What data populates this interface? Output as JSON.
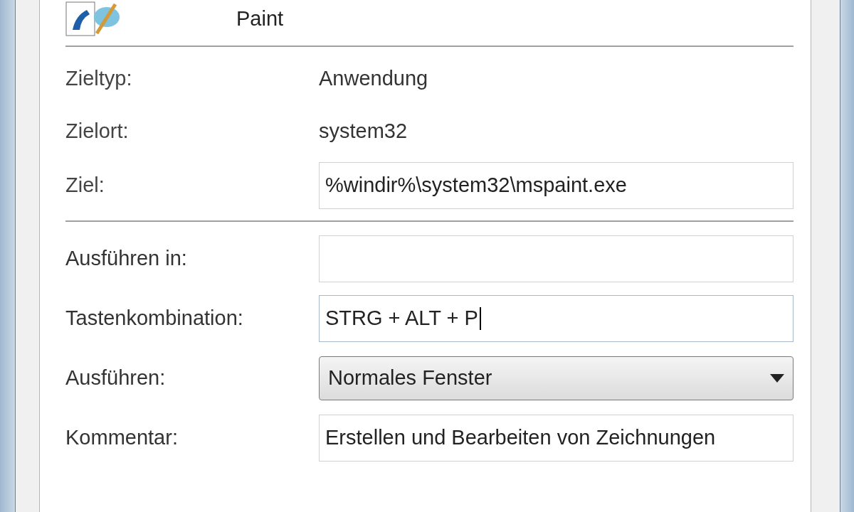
{
  "header": {
    "name": "Paint"
  },
  "info_rows": [
    {
      "label": "Zieltyp:",
      "value": "Anwendung"
    },
    {
      "label": "Zielort:",
      "value": "system32"
    }
  ],
  "target": {
    "label": "Ziel:",
    "value": "%windir%\\system32\\mspaint.exe"
  },
  "fields": [
    {
      "kind": "text",
      "label": "Ausführen in:",
      "focused": false
    },
    {
      "kind": "text",
      "label": "Tastenkombination:",
      "value": "STRG + ALT + P",
      "focused": true
    },
    {
      "kind": "dropdown",
      "label": "Ausführen:",
      "value": "Normales Fenster"
    },
    {
      "kind": "text",
      "label": "Kommentar:",
      "value": "Erstellen und Bearbeiten von Zeichnungen",
      "focused": false
    }
  ]
}
